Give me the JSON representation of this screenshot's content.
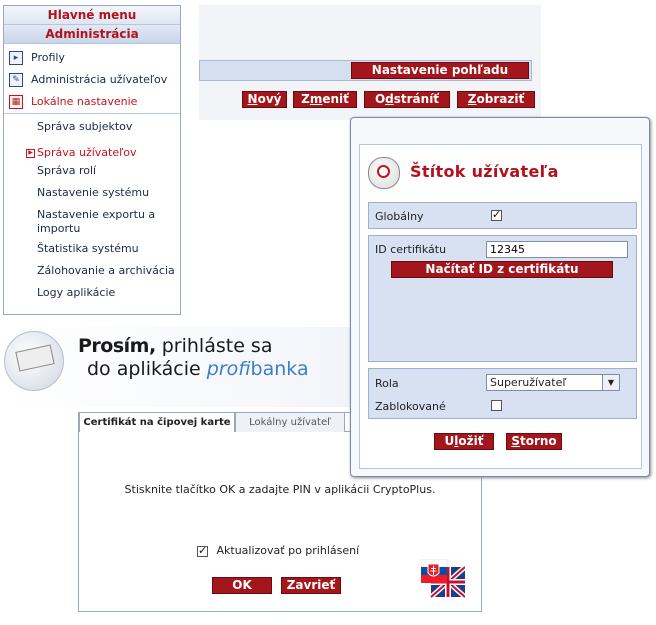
{
  "menu": {
    "header": "Hlavné menu",
    "section": "Administrácia",
    "main_items": [
      {
        "label": "Profily",
        "icon": "profile-icon"
      },
      {
        "label": "Administrácia užívateľov",
        "icon": "users-admin-icon"
      },
      {
        "label": "Lokálne nastavenie",
        "icon": "local-settings-icon",
        "active": true
      }
    ],
    "sub_items": [
      {
        "label": "Správa subjektov"
      },
      {
        "label": "Správa užívateľov",
        "active": true
      },
      {
        "label": "Správa rolí"
      },
      {
        "label": "Nastavenie systému"
      },
      {
        "label": "Nastavenie exportu a importu"
      },
      {
        "label": "Štatistika systému"
      },
      {
        "label": "Zálohovanie a archivácia"
      },
      {
        "label": "Logy aplikácie"
      }
    ]
  },
  "toolbar": {
    "view_settings": "Nastavenie pohľadu",
    "buttons": [
      {
        "pre": "",
        "u": "N",
        "post": "ový"
      },
      {
        "pre": "Z",
        "u": "m",
        "post": "eniť"
      },
      {
        "pre": "O",
        "u": "d",
        "post": "stráníť"
      },
      {
        "pre": "",
        "u": "Z",
        "post": "obraziť"
      }
    ]
  },
  "login": {
    "line1_bold": "Prosím,",
    "line1_rest": " prihláste sa",
    "line2_prefix": "do aplikácie ",
    "brand_italic": "profi",
    "brand_rest": "banka",
    "tab_active": "Certifikát na čipovej karte",
    "tab_inactive": "Lokálny užívateľ",
    "message": "Stisknite tlačítko OK a zadajte PIN v aplikácii CryptoPlus.",
    "update_label": "Aktualizovať po prihlásení",
    "update_checked": true,
    "ok_label": "OK",
    "close_label": "Zavrieť"
  },
  "dialog": {
    "title": "Štítok užívateľa",
    "global_label": "Globálny",
    "global_checked": true,
    "cert_label": "ID certifikátu",
    "cert_value": "12345",
    "load_cert_button": "Načítať ID z certifikátu",
    "role_label": "Rola",
    "role_value": "Superužívateľ",
    "blocked_label": "Zablokované",
    "blocked_checked": false,
    "save_pre": "U",
    "save_u": "l",
    "save_post": "ožiť",
    "cancel_u": "S",
    "cancel_post": "torno"
  },
  "colors": {
    "accent_red": "#a3161c",
    "panel_blue": "#d7e1f1",
    "brand_blue": "#3a7fc9"
  }
}
